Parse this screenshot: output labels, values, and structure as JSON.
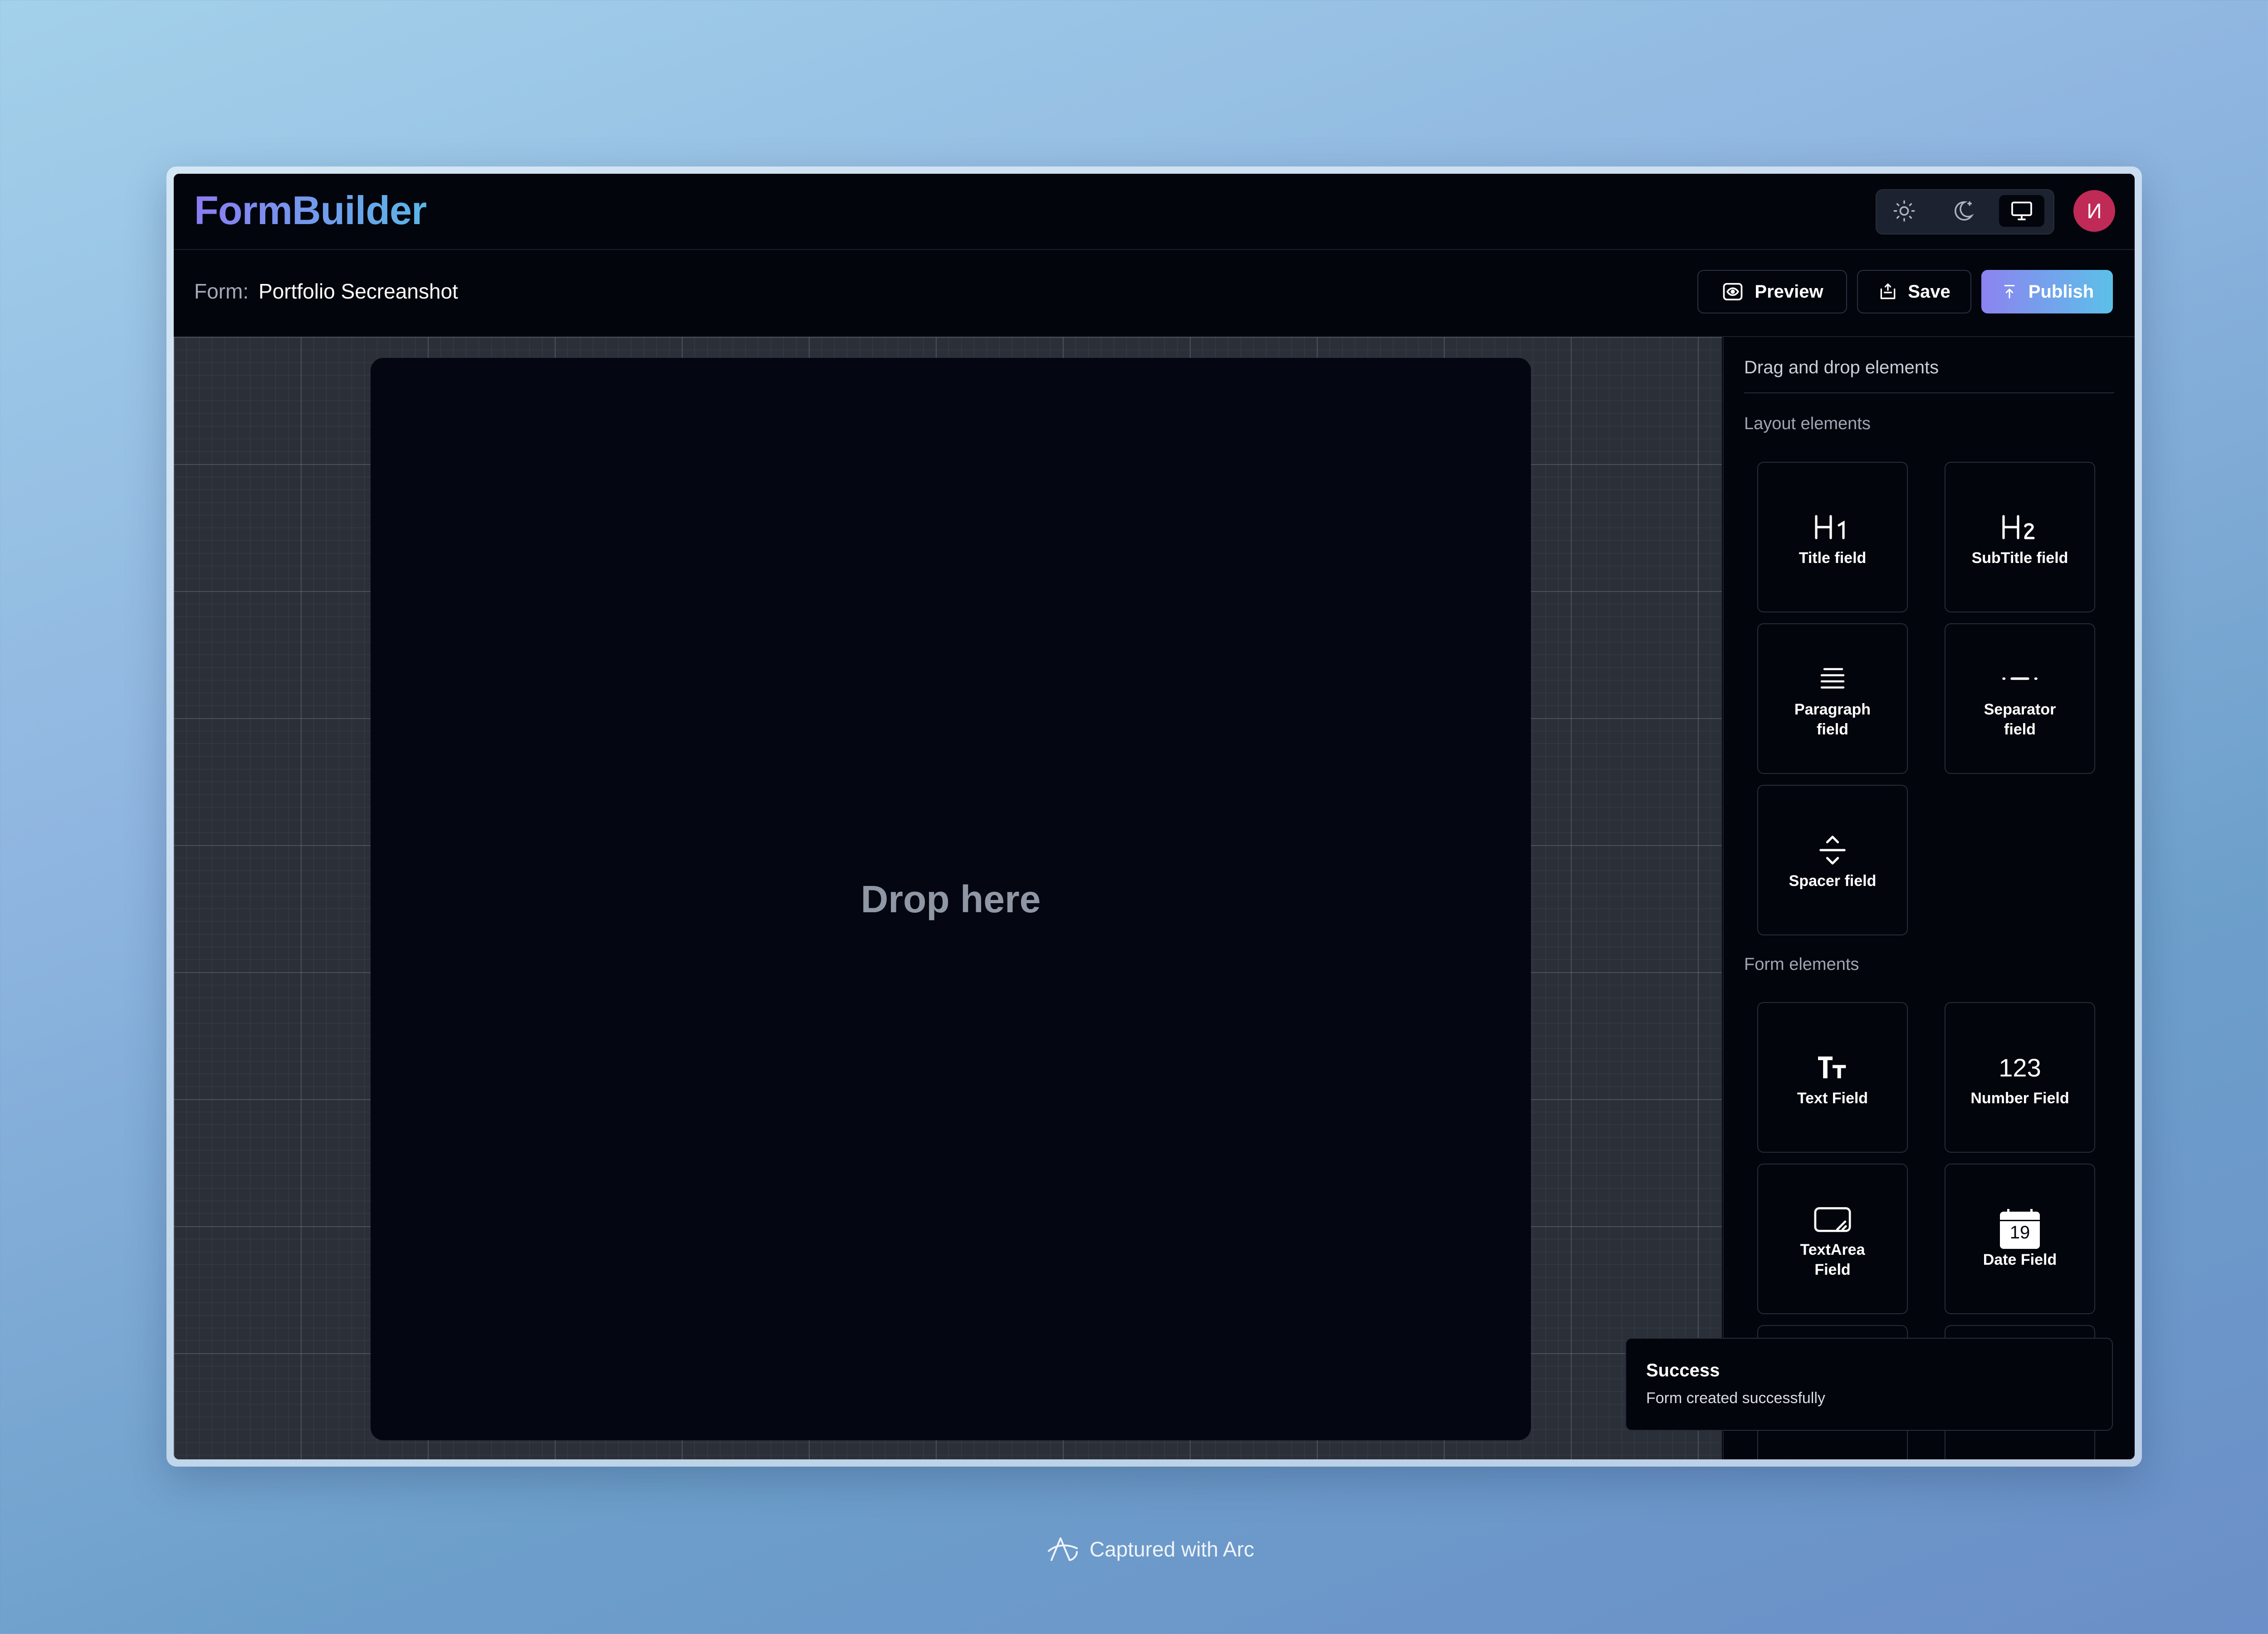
{
  "app": {
    "logo": "FormBuilder",
    "avatar_initial": "И"
  },
  "theme": {
    "options": [
      "sun-icon",
      "moon-icon",
      "monitor-icon"
    ],
    "active": "monitor-icon"
  },
  "form": {
    "label": "Form:",
    "name": "Portfolio Secreanshot"
  },
  "actions": {
    "preview_label": "Preview",
    "save_label": "Save",
    "publish_label": "Publish"
  },
  "canvas": {
    "drop_text": "Drop here"
  },
  "sidebar": {
    "title": "Drag and drop elements",
    "layout_heading": "Layout elements",
    "layout_items": [
      {
        "label": "Title field",
        "icon": "h1-icon"
      },
      {
        "label": "SubTitle field",
        "icon": "h2-icon"
      },
      {
        "label": "Paragraph field",
        "icon": "paragraph-icon"
      },
      {
        "label": "Separator field",
        "icon": "separator-icon"
      },
      {
        "label": "Spacer field",
        "icon": "spacer-icon"
      }
    ],
    "form_heading": "Form elements",
    "form_items": [
      {
        "label": "Text Field",
        "icon": "text-icon"
      },
      {
        "label": "Number Field",
        "icon": "number-icon",
        "glyph": "123"
      },
      {
        "label": "TextArea Field",
        "icon": "textarea-icon"
      },
      {
        "label": "Date Field",
        "icon": "calendar-icon",
        "glyph": "19"
      }
    ]
  },
  "toast": {
    "title": "Success",
    "description": "Form created successfully"
  },
  "footer": {
    "captured": "Captured with Arc"
  },
  "colors": {
    "accent_start": "#8c83f0",
    "accent_end": "#5cc0e8",
    "avatar": "#c02a57",
    "background": "#03050c"
  }
}
